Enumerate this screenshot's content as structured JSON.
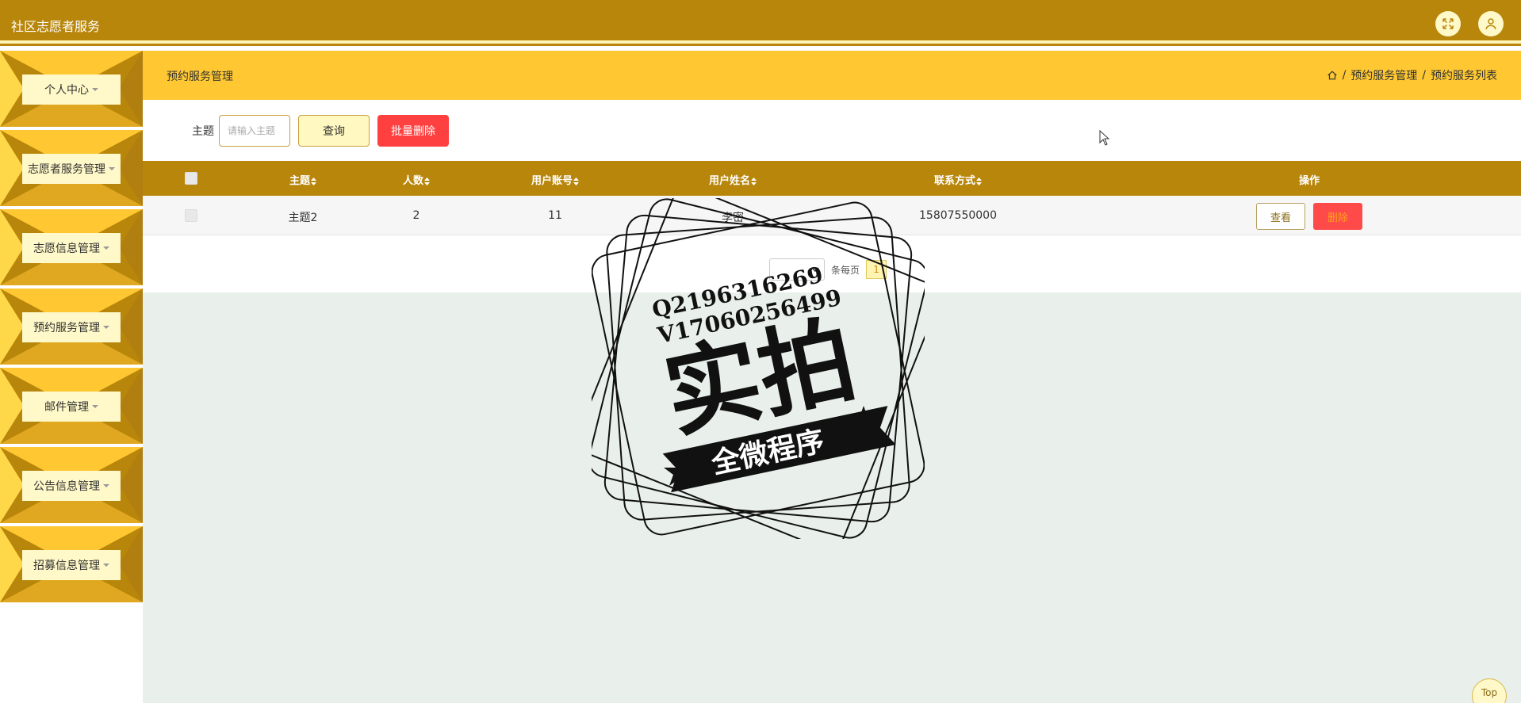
{
  "app": {
    "title": "社区志愿者服务",
    "icons": {
      "fullscreen": "fullscreen-icon",
      "user": "user-icon"
    }
  },
  "sidebar": {
    "items": [
      {
        "label": "个人中心"
      },
      {
        "label": "志愿者服务管理"
      },
      {
        "label": "志愿信息管理"
      },
      {
        "label": "预约服务管理"
      },
      {
        "label": "邮件管理"
      },
      {
        "label": "公告信息管理"
      },
      {
        "label": "招募信息管理"
      }
    ]
  },
  "page": {
    "title": "预约服务管理",
    "breadcrumb": [
      "预约服务管理",
      "预约服务列表"
    ],
    "breadcrumb_sep": "/"
  },
  "search": {
    "label": "主题",
    "placeholder": "请输入主题",
    "query_button": "查询",
    "batch_delete_button": "批量删除"
  },
  "table": {
    "columns": [
      "主题",
      "人数",
      "用户账号",
      "用户姓名",
      "联系方式",
      "操作"
    ],
    "rows": [
      {
        "topic": "主题2",
        "count": "2",
        "account": "11",
        "name": "李密",
        "phone": "15807550000"
      }
    ],
    "actions": {
      "view": "查看",
      "delete": "删除"
    }
  },
  "pagination": {
    "per_page_label": "条每页",
    "page": "1"
  },
  "watermark": {
    "line1": "Q2196316269",
    "line2": "V17060256499",
    "big": "实拍",
    "ribbon": "全微程序"
  },
  "back_to_top": "Top",
  "colors": {
    "header": "#b8860b",
    "accent": "#ffc832",
    "light": "#fff8c8",
    "danger": "#ff4040"
  }
}
